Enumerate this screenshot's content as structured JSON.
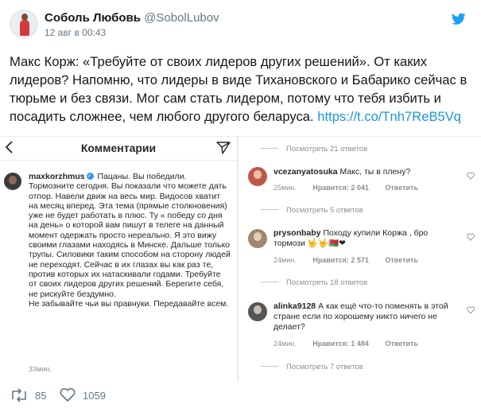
{
  "tweet": {
    "author_name": "Соболь Любовь",
    "author_handle": "@SobolLubov",
    "date": "12 авг в 00:43",
    "text": "Макс Корж: «Требуйте от своих лидеров других решений». От каких лидеров? Напомню, что лидеры в виде Тихановского и Бабарико сейчас в тюрьме и без связи. Мог сам стать лидером, потому что тебя избить и посадить сложнее, чем любого другого беларуса. ",
    "link": "https://t.co/Tnh7ReB5Vq",
    "retweets": "85",
    "likes": "1059",
    "icons": {
      "logo": "twitter-bird-icon",
      "retweet": "retweet-icon",
      "like": "heart-icon"
    },
    "colors": {
      "link": "#1b95e0",
      "bird": "#1da1f2",
      "muted": "#657786"
    }
  },
  "left_panel": {
    "title": "Комментарии",
    "username": "maxkorzhmus",
    "comment": " Пацаны. Вы победили. Тормозните сегодня.  Вы показали  что можете дать отпор. Навели движ на весь мир. Видосов хватит на месяц вперед. Эта тема (прямые столкновения) уже не будет работать в плюс.  Ту « победу со дня на день» о которой вам пишут в телеге на данный момент одержать просто нереально.  Я это вижу своими глазами находясь в Минске. Дальше только трупы.  Силовики таким способом на сторону людей не переходят.  Сейчас в их глазах вы как раз те, против которых их натаскивали годами.  Требуйте от своих лидеров других решений. Берегите себя, не рискуйте бездумно.",
    "comment_end": "Не забывайте чьи вы правнуки. Передавайте всем.",
    "time": "33мин."
  },
  "right_panel": {
    "view_replies_1": "Посмотреть 21 ответов",
    "c1": {
      "user": "vcezanyatosuka",
      "text": "Макс, ты в плену?",
      "time": "25мин.",
      "likes": "Нравится: 2 041",
      "reply": "Ответить"
    },
    "view_replies_2": "Посмотреть 5 ответов",
    "c2": {
      "user": "prysonbaby",
      "text": "Походу купили Коржа , бро тормози 🤟🤟🇧🇾❤",
      "time": "24мин.",
      "likes": "Нравится: 2 571",
      "reply": "Ответить"
    },
    "view_replies_3": "Посмотреть 18 ответов",
    "c3": {
      "user": "alinka9128",
      "text": "А как ещё что-то поменять в этой стране если по хорошему никто ничего не делает?",
      "time": "24мин.",
      "likes": "Нравится: 1 484",
      "reply": "Ответить"
    },
    "view_replies_4": "Посмотреть 7 ответов"
  }
}
